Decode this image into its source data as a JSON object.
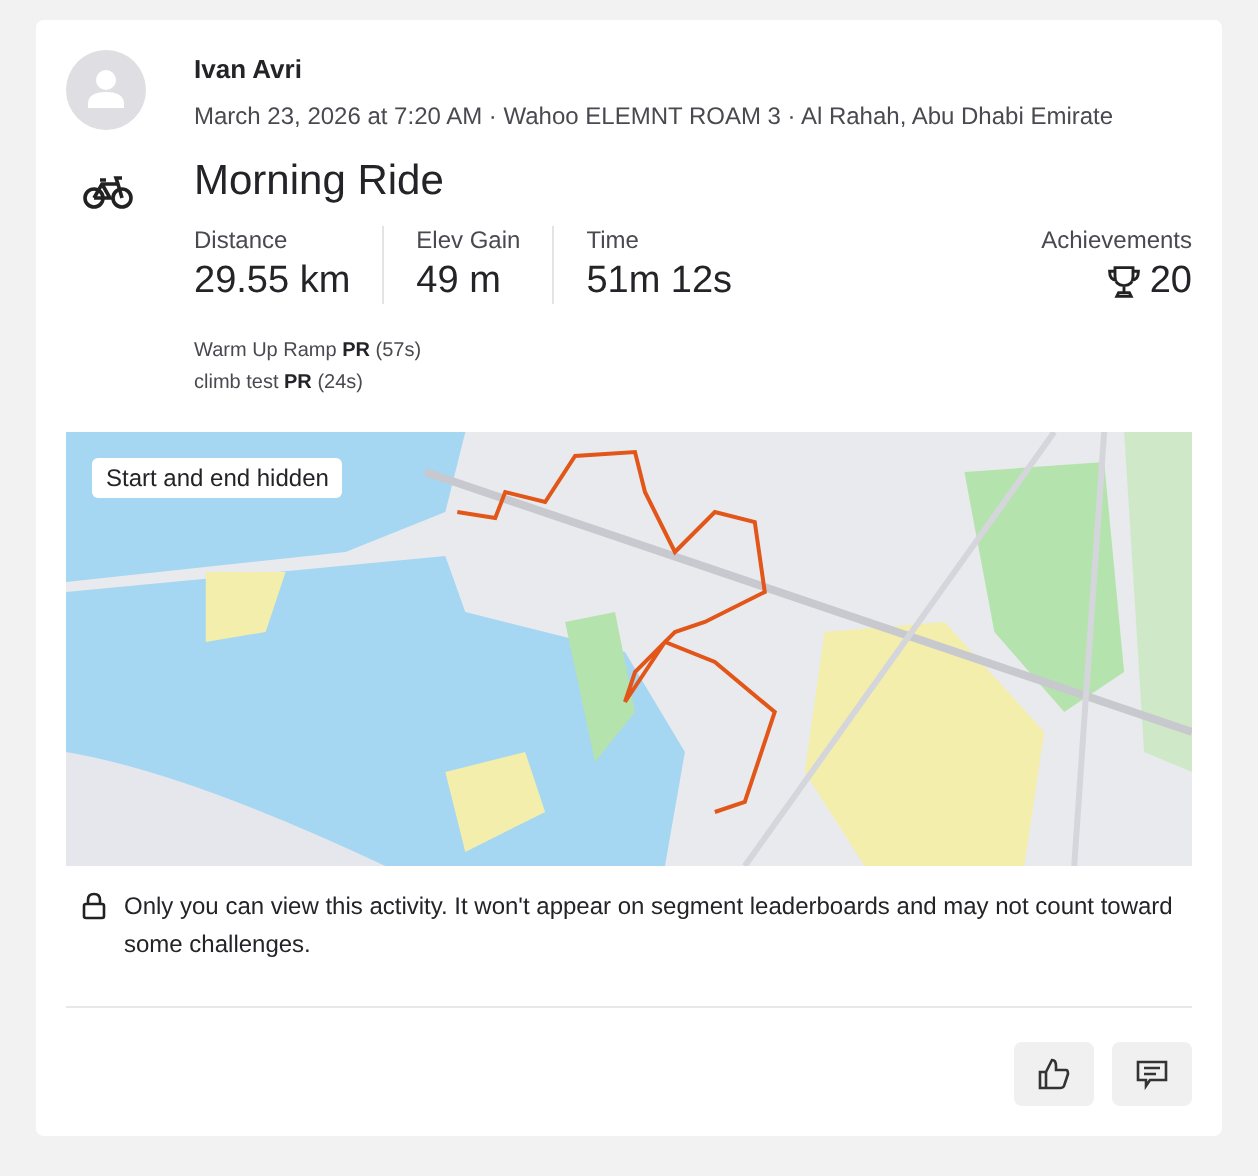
{
  "athlete": {
    "name": "Ivan Avri",
    "meta": "March 23, 2026 at 7:20 AM · Wahoo ELEMNT ROAM 3 · Al Rahah, Abu Dhabi Emirate"
  },
  "activity": {
    "title": "Morning Ride"
  },
  "stats": [
    {
      "label": "Distance",
      "value": "29.55 km"
    },
    {
      "label": "Elev Gain",
      "value": "49 m"
    },
    {
      "label": "Time",
      "value": "51m 12s"
    }
  ],
  "achievements": {
    "label": "Achievements",
    "count": "20"
  },
  "segments": [
    "Warm Up Ramp **PR** (57s)",
    "climb test **PR** (24s)"
  ],
  "map": {
    "kind": "picture",
    "overlay": "Start and end hidden"
  },
  "privacy_note": "Only you can view this activity. It won't appear on segment leaderboards and may not count toward some challenges.",
  "actions": [
    {
      "kind": "like"
    },
    {
      "kind": "comment"
    }
  ]
}
